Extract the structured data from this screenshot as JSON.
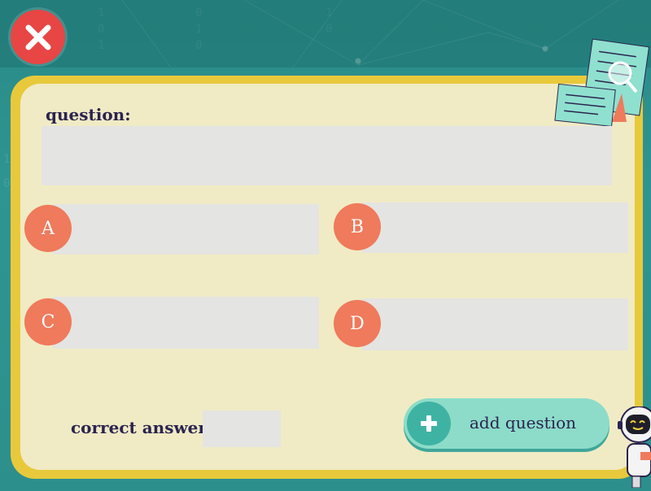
{
  "header": {
    "close_icon": "close-x-icon"
  },
  "form": {
    "question_label": "question:",
    "question_value": "",
    "options": [
      {
        "letter": "A",
        "value": ""
      },
      {
        "letter": "B",
        "value": ""
      },
      {
        "letter": "C",
        "value": ""
      },
      {
        "letter": "D",
        "value": ""
      }
    ],
    "correct_answer_label": "correct answer :",
    "correct_answer_value": "",
    "add_button_label": "add question",
    "add_button_icon": "plus-icon"
  },
  "decor": {
    "document_icon": "document-search-icon",
    "mascot": "robot-mascot"
  },
  "colors": {
    "background": "#2d8f8c",
    "frame": "#e8c93c",
    "card": "#f0ebc4",
    "input": "#e4e4e2",
    "badge": "#ef7a5c",
    "close": "#e84545",
    "button": "#8cdcc9",
    "text": "#2b2450"
  }
}
